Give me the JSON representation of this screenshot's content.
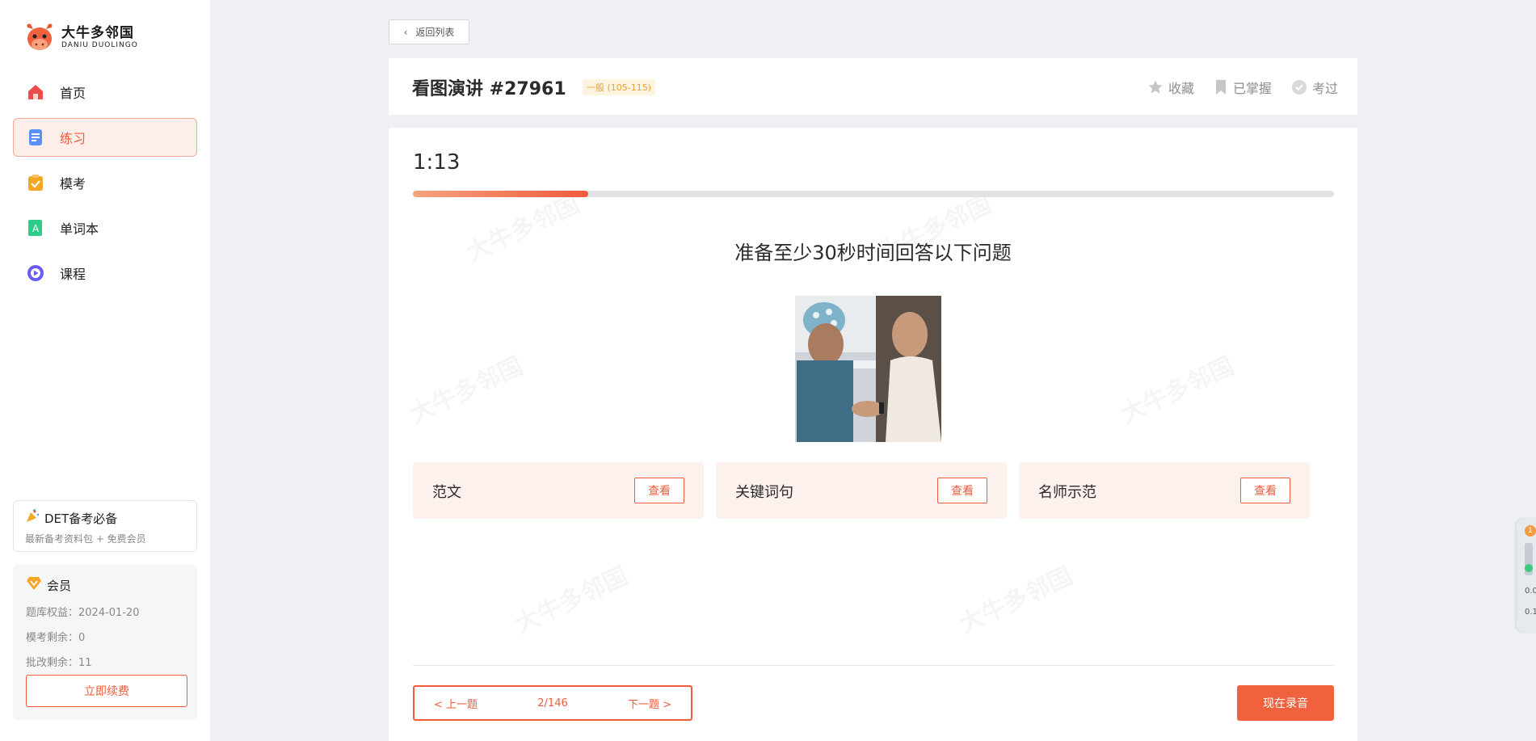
{
  "brand": {
    "name_cn": "大牛多邻国",
    "name_en": "DANIU DUOLINGO"
  },
  "sidebar": {
    "items": [
      {
        "label": "首页",
        "icon": "home-icon",
        "color": "#ec4c4c"
      },
      {
        "label": "练习",
        "icon": "document-icon",
        "color": "#5b8ff9",
        "active": true
      },
      {
        "label": "模考",
        "icon": "clipboard-check-icon",
        "color": "#f5a623"
      },
      {
        "label": "单词本",
        "icon": "vocabulary-book-icon",
        "color": "#2ecc8b"
      },
      {
        "label": "课程",
        "icon": "play-circle-icon",
        "color": "#6b5cf0"
      }
    ],
    "promo": {
      "title": "DET备考必备",
      "subtitle": "最新备考资料包 + 免费会员"
    },
    "member": {
      "title": "会员",
      "bank_label": "题库权益：",
      "bank_value": "2024-01-20",
      "mock_label": "模考剩余：",
      "mock_value": "0",
      "grade_label": "批改剩余：",
      "grade_value": "11",
      "renew_label": "立即续费"
    }
  },
  "back_label": "返回列表",
  "question": {
    "title": "看图演讲 #27961",
    "difficulty": "一般 (105-115)",
    "actions": {
      "favorite": "收藏",
      "mastered": "已掌握",
      "tested": "考过"
    }
  },
  "timer": "1:13",
  "progress": 0.19,
  "instruction": "准备至少30秒时间回答以下问题",
  "resources": [
    {
      "label": "范文",
      "button": "查看"
    },
    {
      "label": "关键词句",
      "button": "查看"
    },
    {
      "label": "名师示范",
      "button": "查看"
    }
  ],
  "pager": {
    "prev": "< 上一题",
    "page": "2/146",
    "next": "下一题 >"
  },
  "record_label": "现在录音",
  "watermark_text": "大牛多邻国",
  "float_widget": {
    "badge": "1",
    "v1": "0.0",
    "v2": "0.1"
  },
  "colors": {
    "accent": "#ef5b3c",
    "badge": "#e8a33a"
  }
}
